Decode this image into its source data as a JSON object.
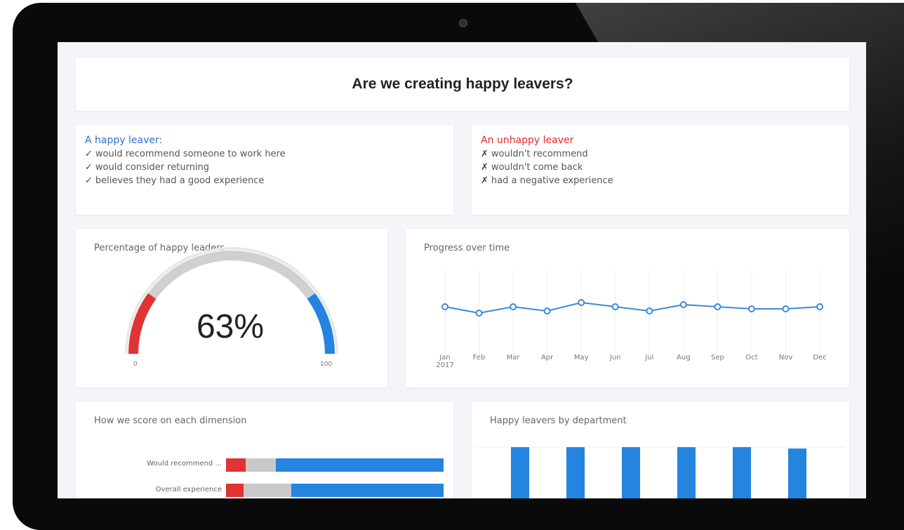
{
  "dashboard": {
    "title": "Are we creating happy leavers?",
    "happy": {
      "heading": "A happy leaver:",
      "items": [
        "would recommend someone to work here",
        "would consider returning",
        "believes they had a good experience"
      ],
      "mark": "✓"
    },
    "unhappy": {
      "heading": "An unhappy leaver",
      "items": [
        "wouldn't recommend",
        "wouldn't come back",
        "had a negative experience"
      ],
      "mark": "✗"
    },
    "gauge": {
      "title": "Percentage of happy leaders",
      "value_text": "63%",
      "value": 63,
      "min_label": "0",
      "max_label": "100",
      "red_fraction": 0.2,
      "blue_from_fraction": 0.8
    },
    "progress": {
      "title": "Progress over time"
    },
    "score": {
      "title": "How we score on each dimension",
      "rows": [
        {
          "label": "Would recommend ...",
          "red": 9,
          "grey": 14,
          "blue": 77
        },
        {
          "label": "Overall experience",
          "red": 8,
          "grey": 22,
          "blue": 70
        }
      ]
    },
    "dept": {
      "title": "Happy leavers by department"
    }
  },
  "colors": {
    "accent_blue": "#2484e0",
    "red": "#e03333",
    "grey": "#c9c9c9",
    "line": "#3b8ad8"
  },
  "chart_data": [
    {
      "type": "line",
      "title": "Progress over time",
      "x": [
        "Jan",
        "Feb",
        "Mar",
        "Apr",
        "May",
        "Jun",
        "Jul",
        "Aug",
        "Sep",
        "Oct",
        "Nov",
        "Dec"
      ],
      "x_sublabel_first": "2017",
      "series": [
        {
          "values": [
            63,
            60,
            63,
            61,
            65,
            63,
            61,
            64,
            63,
            62,
            62,
            63
          ]
        }
      ],
      "ylim": [
        40,
        80
      ],
      "grid": true
    },
    {
      "type": "bar",
      "title": "Happy leavers by department",
      "categories": [
        "",
        "",
        "",
        "",
        "",
        ""
      ],
      "values": [
        100,
        100,
        100,
        100,
        100,
        98
      ],
      "ylim": [
        0,
        100
      ]
    }
  ]
}
